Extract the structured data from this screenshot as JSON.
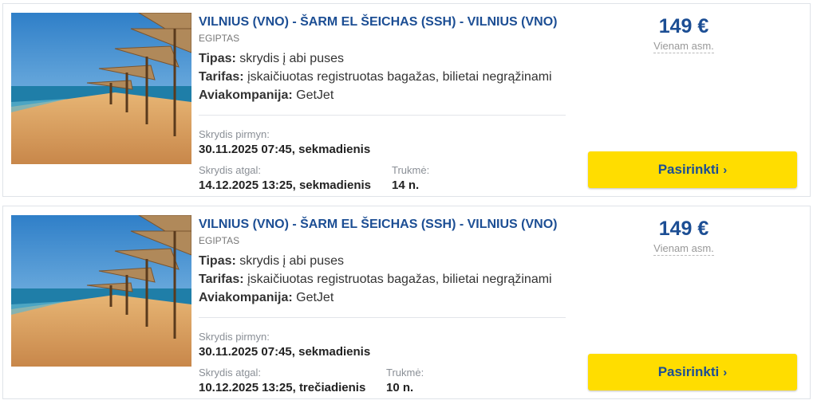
{
  "offers": [
    {
      "route": "VILNIUS (VNO) - ŠARM EL ŠEICHAS (SSH) - VILNIUS (VNO)",
      "country": "EGIPTAS",
      "type_label": "Tipas:",
      "type_value": "skrydis į abi puses",
      "fare_label": "Tarifas:",
      "fare_value": "įskaičiuotas registruotas bagažas, bilietai negrąžinami",
      "airline_label": "Aviakompanija:",
      "airline_value": "GetJet",
      "outbound_label": "Skrydis pirmyn:",
      "outbound_value": "30.11.2025 07:45, sekmadienis",
      "return_label": "Skrydis atgal:",
      "return_value": "14.12.2025 13:25, sekmadienis",
      "duration_label": "Trukmė:",
      "duration_value": "14 n.",
      "price": "149 €",
      "price_note": "Vienam asm.",
      "button_label": "Pasirinkti",
      "button_icon": "chevron-right-icon"
    },
    {
      "route": "VILNIUS (VNO) - ŠARM EL ŠEICHAS (SSH) - VILNIUS (VNO)",
      "country": "EGIPTAS",
      "type_label": "Tipas:",
      "type_value": "skrydis į abi puses",
      "fare_label": "Tarifas:",
      "fare_value": "įskaičiuotas registruotas bagažas, bilietai negrąžinami",
      "airline_label": "Aviakompanija:",
      "airline_value": "GetJet",
      "outbound_label": "Skrydis pirmyn:",
      "outbound_value": "30.11.2025 07:45, sekmadienis",
      "return_label": "Skrydis atgal:",
      "return_value": "10.12.2025 13:25, trečiadienis",
      "duration_label": "Trukmė:",
      "duration_value": "10 n.",
      "price": "149 €",
      "price_note": "Vienam asm.",
      "button_label": "Pasirinkti",
      "button_icon": "chevron-right-icon"
    }
  ],
  "colors": {
    "accent_blue": "#1c4e94",
    "button_yellow": "#ffdd00",
    "border": "#dfe3e8"
  }
}
